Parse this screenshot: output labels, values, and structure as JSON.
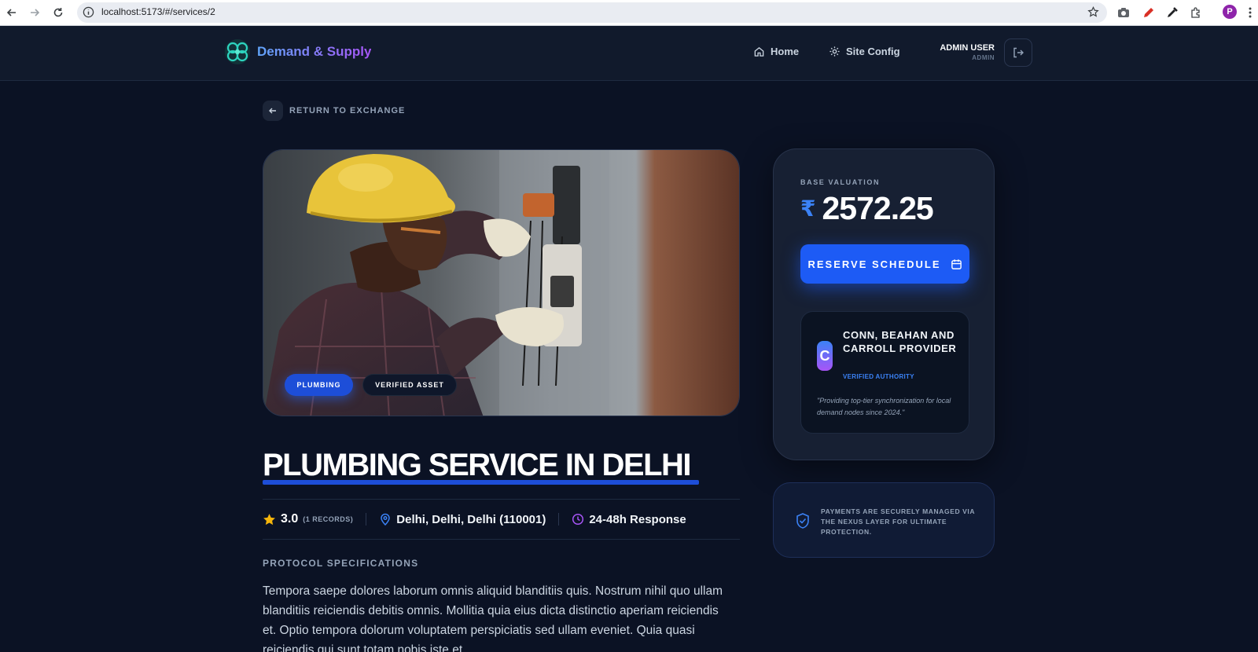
{
  "browser": {
    "url": "localhost:5173/#/services/2",
    "profile_initial": "P"
  },
  "header": {
    "brand": "Demand & Supply",
    "nav": [
      {
        "label": "Home",
        "icon": "home-icon"
      },
      {
        "label": "Site Config",
        "icon": "gear-icon"
      }
    ],
    "user_name": "ADMIN USER",
    "user_role": "ADMIN"
  },
  "back_link": "RETURN TO EXCHANGE",
  "hero": {
    "tags": [
      "PLUMBING",
      "VERIFIED ASSET"
    ]
  },
  "service": {
    "title": "PLUMBING SERVICE IN DELHI",
    "rating": "3.0",
    "records": "(1 RECORDS)",
    "location": "Delhi, Delhi, Delhi (110001)",
    "response": "24-48h Response",
    "spec_heading": "PROTOCOL SPECIFICATIONS",
    "description": "Tempora saepe dolores laborum omnis aliquid blanditiis quis. Nostrum nihil quo ullam blanditiis reiciendis debitis omnis. Mollitia quia eius dicta distinctio aperiam reiciendis et. Optio tempora dolorum voluptatem perspiciatis sed ullam eveniet. Quia quasi reiciendis qui sunt totam nobis iste et."
  },
  "pricing": {
    "label": "BASE VALUATION",
    "currency": "₹",
    "amount": "2572.25",
    "reserve_label": "RESERVE SCHEDULE"
  },
  "provider": {
    "initial": "C",
    "name": "CONN, BEAHAN AND CARROLL PROVIDER",
    "badge": "VERIFIED AUTHORITY",
    "quote": "\"Providing top-tier synchronization for local demand nodes since 2024.\""
  },
  "secure_note": "PAYMENTS ARE SECURELY MANAGED VIA THE NEXUS LAYER FOR ULTIMATE PROTECTION.",
  "colors": {
    "background": "#0b1224",
    "accent": "#1d5bf5",
    "rating_star": "#f5b50b",
    "location_icon": "#3b82f6",
    "clock_icon": "#a855f7"
  }
}
